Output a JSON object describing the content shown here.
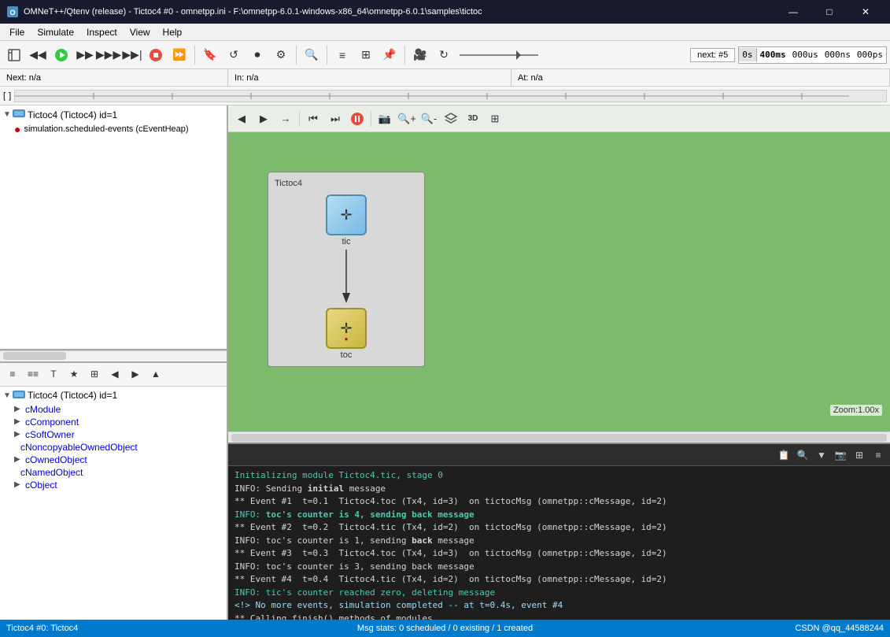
{
  "titleBar": {
    "title": "OMNeT++/Qtenv (release) - Tictoc4 #0  -  omnetpp.ini - F:\\omnetpp-6.0.1-windows-x86_64\\omnetpp-6.0.1\\samples\\tictoc",
    "minimize": "—",
    "maximize": "□",
    "close": "✕"
  },
  "menuBar": {
    "items": [
      "File",
      "Simulate",
      "Inspect",
      "View",
      "Help"
    ]
  },
  "toolbar": {
    "nextLabel": "next: #5",
    "time": {
      "s": "0s",
      "ms": "400ms",
      "us": "000us",
      "ns": "000ns",
      "ps": "000ps"
    }
  },
  "statusBar": {
    "next": "Next: n/a",
    "in": "In: n/a",
    "at": "At: n/a"
  },
  "leftPanel": {
    "rootItem": "Tictoc4 (Tictoc4) id=1",
    "rootIcon": "📦",
    "children": [
      {
        "label": "simulation.scheduled-events (cEventHeap)",
        "icon": "🔴",
        "indent": 16
      }
    ],
    "toolbar2": {
      "buttons": [
        "≡",
        "≡≡",
        "T",
        "★",
        "⊞",
        "◀",
        "▶",
        "▲"
      ]
    },
    "tree2Root": "Tictoc4 (Tictoc4) id=1",
    "tree2Icon": "📦",
    "tree2Children": [
      {
        "label": "cModule",
        "indent": 16,
        "expandable": true
      },
      {
        "label": "cComponent",
        "indent": 16,
        "expandable": true
      },
      {
        "label": "cSoftOwner",
        "indent": 16,
        "expandable": true
      },
      {
        "label": "cNoncopyableOwnedObject",
        "indent": 24,
        "expandable": false
      },
      {
        "label": "cOwnedObject",
        "indent": 16,
        "expandable": true
      },
      {
        "label": "cNamedObject",
        "indent": 24,
        "expandable": false
      },
      {
        "label": "cObject",
        "indent": 16,
        "expandable": true
      }
    ]
  },
  "canvas": {
    "networkName": "Tictoc4",
    "nodeNames": [
      "tic",
      "toc"
    ],
    "zoomLabel": "Zoom:1.00x"
  },
  "canvasToolbar": {
    "buttons": [
      "◀",
      "▶",
      "→",
      "⏮",
      "⏭",
      "⏸",
      "📷",
      "🔍+",
      "🔍-",
      "⊕",
      "3D",
      "⊞"
    ]
  },
  "logPanel": {
    "lines": [
      {
        "type": "info",
        "text": "Initializing module Tictoc4.tic, stage 0"
      },
      {
        "type": "event",
        "text": "INFO: Sending initial message"
      },
      {
        "type": "event",
        "text": "** Event #1  t=0.1  Tictoc4.toc (Tx4, id=3)  on tictocMsg (omnetpp::cMessage, id=2)"
      },
      {
        "type": "info",
        "text": "INFO: toc's counter is 4, sending back message"
      },
      {
        "type": "event",
        "text": "** Event #2  t=0.2  Tictoc4.tic (Tx4, id=2)  on tictocMsg (omnetpp::cMessage, id=2)"
      },
      {
        "type": "event",
        "text": "INFO: toc's counter is 1, sending back message"
      },
      {
        "type": "event",
        "text": "** Event #3  t=0.3  Tictoc4.toc (Tx4, id=3)  on tictocMsg (omnetpp::cMessage, id=2)"
      },
      {
        "type": "event",
        "text": "INFO: toc's counter is 3, sending back message"
      },
      {
        "type": "event",
        "text": "** Event #4  t=0.4  Tictoc4.tic (Tx4, id=2)  on tictocMsg (omnetpp::cMessage, id=2)"
      },
      {
        "type": "info",
        "text": "INFO: tic's counter reached zero, deleting message"
      },
      {
        "type": "complete",
        "text": "<!> No more events, simulation completed -- at t=0.4s, event #4"
      },
      {
        "type": "event",
        "text": "** Calling finish() methods of modules"
      }
    ]
  },
  "bottomStatus": {
    "left": "Tictoc4 #0: Tictoc4",
    "mid": "Msg stats: 0 scheduled / 0 existing / 1 created",
    "right": "CSDN @qq_44588244"
  }
}
